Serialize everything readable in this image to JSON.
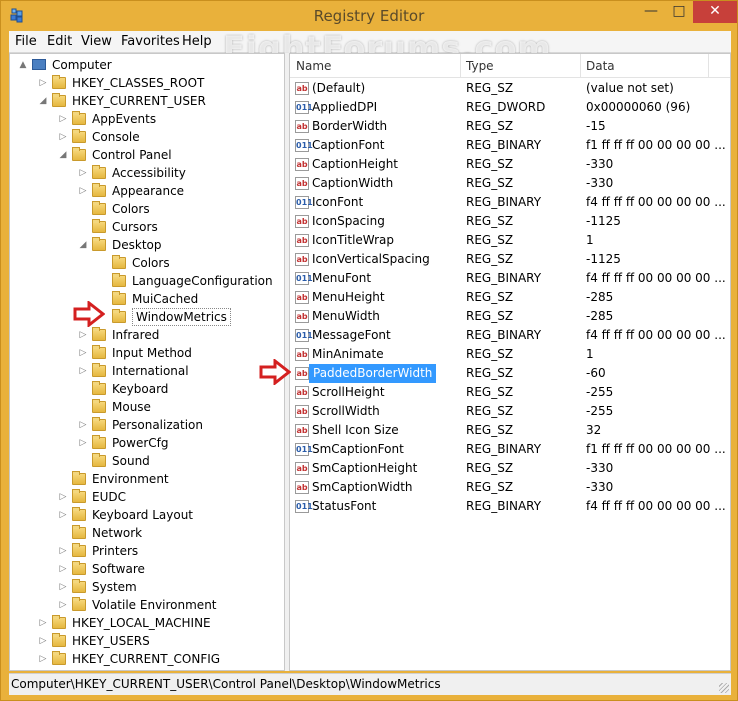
{
  "window": {
    "title": "Registry Editor"
  },
  "watermark": "EightForums.com",
  "menu": [
    {
      "label": "File",
      "u": "F",
      "rest": "ile"
    },
    {
      "label": "Edit",
      "u": "E",
      "rest": "dit"
    },
    {
      "label": "View",
      "u": "V",
      "rest": "iew"
    },
    {
      "label": "Favorites",
      "u": "F",
      "pre": "",
      "rest": "avorites",
      "underline_index": 1
    },
    {
      "label": "Help",
      "u": "H",
      "rest": "elp"
    }
  ],
  "tree": [
    {
      "label": "Computer",
      "level": 0,
      "arrow": "▲",
      "icon": "computer-icon"
    },
    {
      "label": "HKEY_CLASSES_ROOT",
      "level": 1,
      "arrow": "▷"
    },
    {
      "label": "HKEY_CURRENT_USER",
      "level": 1,
      "arrow": "◢"
    },
    {
      "label": "AppEvents",
      "level": 2,
      "arrow": "▷"
    },
    {
      "label": "Console",
      "level": 2,
      "arrow": "▷"
    },
    {
      "label": "Control Panel",
      "level": 2,
      "arrow": "◢"
    },
    {
      "label": "Accessibility",
      "level": 3,
      "arrow": "▷"
    },
    {
      "label": "Appearance",
      "level": 3,
      "arrow": "▷"
    },
    {
      "label": "Colors",
      "level": 3,
      "arrow": ""
    },
    {
      "label": "Cursors",
      "level": 3,
      "arrow": ""
    },
    {
      "label": "Desktop",
      "level": 3,
      "arrow": "◢"
    },
    {
      "label": "Colors",
      "level": 4,
      "arrow": ""
    },
    {
      "label": "LanguageConfiguration",
      "level": 4,
      "arrow": ""
    },
    {
      "label": "MuiCached",
      "level": 4,
      "arrow": ""
    },
    {
      "label": "WindowMetrics",
      "level": 4,
      "arrow": "",
      "selected": true
    },
    {
      "label": "Infrared",
      "level": 3,
      "arrow": "▷"
    },
    {
      "label": "Input Method",
      "level": 3,
      "arrow": "▷"
    },
    {
      "label": "International",
      "level": 3,
      "arrow": "▷"
    },
    {
      "label": "Keyboard",
      "level": 3,
      "arrow": ""
    },
    {
      "label": "Mouse",
      "level": 3,
      "arrow": ""
    },
    {
      "label": "Personalization",
      "level": 3,
      "arrow": "▷"
    },
    {
      "label": "PowerCfg",
      "level": 3,
      "arrow": "▷"
    },
    {
      "label": "Sound",
      "level": 3,
      "arrow": ""
    },
    {
      "label": "Environment",
      "level": 2,
      "arrow": ""
    },
    {
      "label": "EUDC",
      "level": 2,
      "arrow": "▷"
    },
    {
      "label": "Keyboard Layout",
      "level": 2,
      "arrow": "▷"
    },
    {
      "label": "Network",
      "level": 2,
      "arrow": ""
    },
    {
      "label": "Printers",
      "level": 2,
      "arrow": "▷"
    },
    {
      "label": "Software",
      "level": 2,
      "arrow": "▷"
    },
    {
      "label": "System",
      "level": 2,
      "arrow": "▷"
    },
    {
      "label": "Volatile Environment",
      "level": 2,
      "arrow": "▷"
    },
    {
      "label": "HKEY_LOCAL_MACHINE",
      "level": 1,
      "arrow": "▷"
    },
    {
      "label": "HKEY_USERS",
      "level": 1,
      "arrow": "▷"
    },
    {
      "label": "HKEY_CURRENT_CONFIG",
      "level": 1,
      "arrow": "▷"
    }
  ],
  "list": {
    "columns": [
      "Name",
      "Type",
      "Data"
    ],
    "rows": [
      {
        "name": "(Default)",
        "type": "REG_SZ",
        "data": "(value not set)",
        "icon": "sz"
      },
      {
        "name": "AppliedDPI",
        "type": "REG_DWORD",
        "data": "0x00000060 (96)",
        "icon": "bin"
      },
      {
        "name": "BorderWidth",
        "type": "REG_SZ",
        "data": "-15",
        "icon": "sz"
      },
      {
        "name": "CaptionFont",
        "type": "REG_BINARY",
        "data": "f1 ff ff ff 00 00 00 00 ...",
        "icon": "bin"
      },
      {
        "name": "CaptionHeight",
        "type": "REG_SZ",
        "data": "-330",
        "icon": "sz"
      },
      {
        "name": "CaptionWidth",
        "type": "REG_SZ",
        "data": "-330",
        "icon": "sz"
      },
      {
        "name": "IconFont",
        "type": "REG_BINARY",
        "data": "f4 ff ff ff 00 00 00 00 ...",
        "icon": "bin"
      },
      {
        "name": "IconSpacing",
        "type": "REG_SZ",
        "data": "-1125",
        "icon": "sz"
      },
      {
        "name": "IconTitleWrap",
        "type": "REG_SZ",
        "data": "1",
        "icon": "sz"
      },
      {
        "name": "IconVerticalSpacing",
        "type": "REG_SZ",
        "data": "-1125",
        "icon": "sz"
      },
      {
        "name": "MenuFont",
        "type": "REG_BINARY",
        "data": "f4 ff ff ff 00 00 00 00 ...",
        "icon": "bin"
      },
      {
        "name": "MenuHeight",
        "type": "REG_SZ",
        "data": "-285",
        "icon": "sz"
      },
      {
        "name": "MenuWidth",
        "type": "REG_SZ",
        "data": "-285",
        "icon": "sz"
      },
      {
        "name": "MessageFont",
        "type": "REG_BINARY",
        "data": "f4 ff ff ff 00 00 00 00 ...",
        "icon": "bin"
      },
      {
        "name": "MinAnimate",
        "type": "REG_SZ",
        "data": "1",
        "icon": "sz"
      },
      {
        "name": "PaddedBorderWidth",
        "type": "REG_SZ",
        "data": "-60",
        "icon": "sz",
        "highlight": true
      },
      {
        "name": "ScrollHeight",
        "type": "REG_SZ",
        "data": "-255",
        "icon": "sz"
      },
      {
        "name": "ScrollWidth",
        "type": "REG_SZ",
        "data": "-255",
        "icon": "sz"
      },
      {
        "name": "Shell Icon Size",
        "type": "REG_SZ",
        "data": "32",
        "icon": "sz"
      },
      {
        "name": "SmCaptionFont",
        "type": "REG_BINARY",
        "data": "f1 ff ff ff 00 00 00 00 ...",
        "icon": "bin"
      },
      {
        "name": "SmCaptionHeight",
        "type": "REG_SZ",
        "data": "-330",
        "icon": "sz"
      },
      {
        "name": "SmCaptionWidth",
        "type": "REG_SZ",
        "data": "-330",
        "icon": "sz"
      },
      {
        "name": "StatusFont",
        "type": "REG_BINARY",
        "data": "f4 ff ff ff 00 00 00 00 ...",
        "icon": "bin"
      }
    ]
  },
  "status": {
    "path": "Computer\\HKEY_CURRENT_USER\\Control Panel\\Desktop\\WindowMetrics"
  },
  "icon_glyphs": {
    "sz": "ab",
    "bin": "011"
  },
  "colors": {
    "frame": "#e9b13b",
    "close": "#c7403a",
    "highlight": "#3399ff",
    "arrow": "#d42020"
  }
}
